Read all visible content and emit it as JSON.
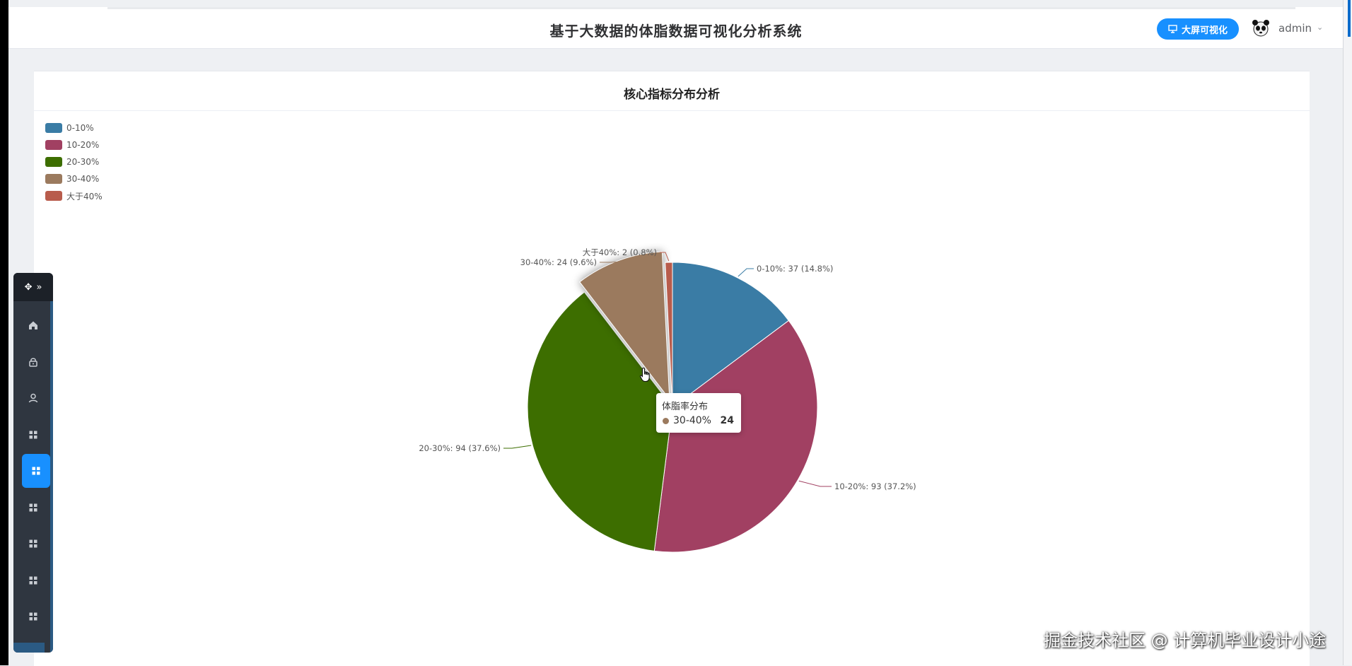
{
  "header": {
    "title": "基于大数据的体脂数据可视化分析系统",
    "screen_button_label": "大屏可视化",
    "username": "admin"
  },
  "card": {
    "title": "核心指标分布分析"
  },
  "tooltip": {
    "title": "体脂率分布",
    "label": "30-40%",
    "value": "24"
  },
  "sidebar": {
    "items": [
      "home-icon",
      "lock-icon",
      "user-icon",
      "grid-icon",
      "grid-icon",
      "grid-icon",
      "grid-icon",
      "grid-icon",
      "grid-icon"
    ],
    "active_index": 4
  },
  "watermark": "掘金技术社区 @ 计算机毕业设计小途",
  "chart_data": {
    "type": "pie",
    "series_name": "体脂率分布",
    "categories": [
      "0-10%",
      "10-20%",
      "20-30%",
      "30-40%",
      "大于40%"
    ],
    "values": [
      37,
      93,
      94,
      24,
      2
    ],
    "percent_labels": [
      "14.8%",
      "37.2%",
      "37.6%",
      "9.6%",
      "0.8%"
    ],
    "data_labels": [
      "0-10%: 37 (14.8%)",
      "10-20%: 93 (37.2%)",
      "20-30%: 94 (37.6%)",
      "30-40%: 24 (9.6%)",
      "大于40%: 2 (0.8%)"
    ],
    "colors": [
      "#3a7ca5",
      "#a14062",
      "#3d6e00",
      "#9b7a5e",
      "#b85c4c"
    ],
    "legend_position": "top-left",
    "highlighted": "30-40%"
  }
}
